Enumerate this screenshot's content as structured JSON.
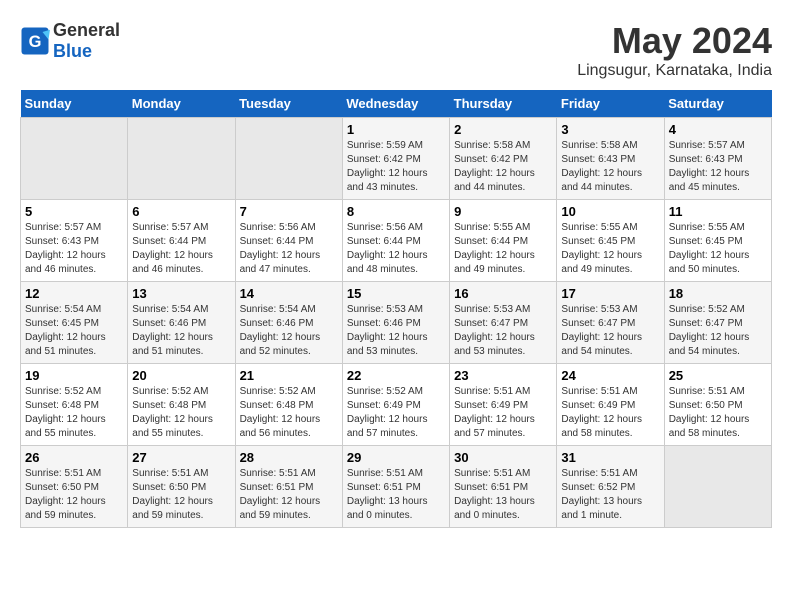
{
  "logo": {
    "general": "General",
    "blue": "Blue"
  },
  "title": "May 2024",
  "subtitle": "Lingsugur, Karnataka, India",
  "days_header": [
    "Sunday",
    "Monday",
    "Tuesday",
    "Wednesday",
    "Thursday",
    "Friday",
    "Saturday"
  ],
  "weeks": [
    [
      {
        "day": "",
        "info": ""
      },
      {
        "day": "",
        "info": ""
      },
      {
        "day": "",
        "info": ""
      },
      {
        "day": "1",
        "info": "Sunrise: 5:59 AM\nSunset: 6:42 PM\nDaylight: 12 hours\nand 43 minutes."
      },
      {
        "day": "2",
        "info": "Sunrise: 5:58 AM\nSunset: 6:42 PM\nDaylight: 12 hours\nand 44 minutes."
      },
      {
        "day": "3",
        "info": "Sunrise: 5:58 AM\nSunset: 6:43 PM\nDaylight: 12 hours\nand 44 minutes."
      },
      {
        "day": "4",
        "info": "Sunrise: 5:57 AM\nSunset: 6:43 PM\nDaylight: 12 hours\nand 45 minutes."
      }
    ],
    [
      {
        "day": "5",
        "info": "Sunrise: 5:57 AM\nSunset: 6:43 PM\nDaylight: 12 hours\nand 46 minutes."
      },
      {
        "day": "6",
        "info": "Sunrise: 5:57 AM\nSunset: 6:44 PM\nDaylight: 12 hours\nand 46 minutes."
      },
      {
        "day": "7",
        "info": "Sunrise: 5:56 AM\nSunset: 6:44 PM\nDaylight: 12 hours\nand 47 minutes."
      },
      {
        "day": "8",
        "info": "Sunrise: 5:56 AM\nSunset: 6:44 PM\nDaylight: 12 hours\nand 48 minutes."
      },
      {
        "day": "9",
        "info": "Sunrise: 5:55 AM\nSunset: 6:44 PM\nDaylight: 12 hours\nand 49 minutes."
      },
      {
        "day": "10",
        "info": "Sunrise: 5:55 AM\nSunset: 6:45 PM\nDaylight: 12 hours\nand 49 minutes."
      },
      {
        "day": "11",
        "info": "Sunrise: 5:55 AM\nSunset: 6:45 PM\nDaylight: 12 hours\nand 50 minutes."
      }
    ],
    [
      {
        "day": "12",
        "info": "Sunrise: 5:54 AM\nSunset: 6:45 PM\nDaylight: 12 hours\nand 51 minutes."
      },
      {
        "day": "13",
        "info": "Sunrise: 5:54 AM\nSunset: 6:46 PM\nDaylight: 12 hours\nand 51 minutes."
      },
      {
        "day": "14",
        "info": "Sunrise: 5:54 AM\nSunset: 6:46 PM\nDaylight: 12 hours\nand 52 minutes."
      },
      {
        "day": "15",
        "info": "Sunrise: 5:53 AM\nSunset: 6:46 PM\nDaylight: 12 hours\nand 53 minutes."
      },
      {
        "day": "16",
        "info": "Sunrise: 5:53 AM\nSunset: 6:47 PM\nDaylight: 12 hours\nand 53 minutes."
      },
      {
        "day": "17",
        "info": "Sunrise: 5:53 AM\nSunset: 6:47 PM\nDaylight: 12 hours\nand 54 minutes."
      },
      {
        "day": "18",
        "info": "Sunrise: 5:52 AM\nSunset: 6:47 PM\nDaylight: 12 hours\nand 54 minutes."
      }
    ],
    [
      {
        "day": "19",
        "info": "Sunrise: 5:52 AM\nSunset: 6:48 PM\nDaylight: 12 hours\nand 55 minutes."
      },
      {
        "day": "20",
        "info": "Sunrise: 5:52 AM\nSunset: 6:48 PM\nDaylight: 12 hours\nand 55 minutes."
      },
      {
        "day": "21",
        "info": "Sunrise: 5:52 AM\nSunset: 6:48 PM\nDaylight: 12 hours\nand 56 minutes."
      },
      {
        "day": "22",
        "info": "Sunrise: 5:52 AM\nSunset: 6:49 PM\nDaylight: 12 hours\nand 57 minutes."
      },
      {
        "day": "23",
        "info": "Sunrise: 5:51 AM\nSunset: 6:49 PM\nDaylight: 12 hours\nand 57 minutes."
      },
      {
        "day": "24",
        "info": "Sunrise: 5:51 AM\nSunset: 6:49 PM\nDaylight: 12 hours\nand 58 minutes."
      },
      {
        "day": "25",
        "info": "Sunrise: 5:51 AM\nSunset: 6:50 PM\nDaylight: 12 hours\nand 58 minutes."
      }
    ],
    [
      {
        "day": "26",
        "info": "Sunrise: 5:51 AM\nSunset: 6:50 PM\nDaylight: 12 hours\nand 59 minutes."
      },
      {
        "day": "27",
        "info": "Sunrise: 5:51 AM\nSunset: 6:50 PM\nDaylight: 12 hours\nand 59 minutes."
      },
      {
        "day": "28",
        "info": "Sunrise: 5:51 AM\nSunset: 6:51 PM\nDaylight: 12 hours\nand 59 minutes."
      },
      {
        "day": "29",
        "info": "Sunrise: 5:51 AM\nSunset: 6:51 PM\nDaylight: 13 hours\nand 0 minutes."
      },
      {
        "day": "30",
        "info": "Sunrise: 5:51 AM\nSunset: 6:51 PM\nDaylight: 13 hours\nand 0 minutes."
      },
      {
        "day": "31",
        "info": "Sunrise: 5:51 AM\nSunset: 6:52 PM\nDaylight: 13 hours\nand 1 minute."
      },
      {
        "day": "",
        "info": ""
      }
    ]
  ]
}
